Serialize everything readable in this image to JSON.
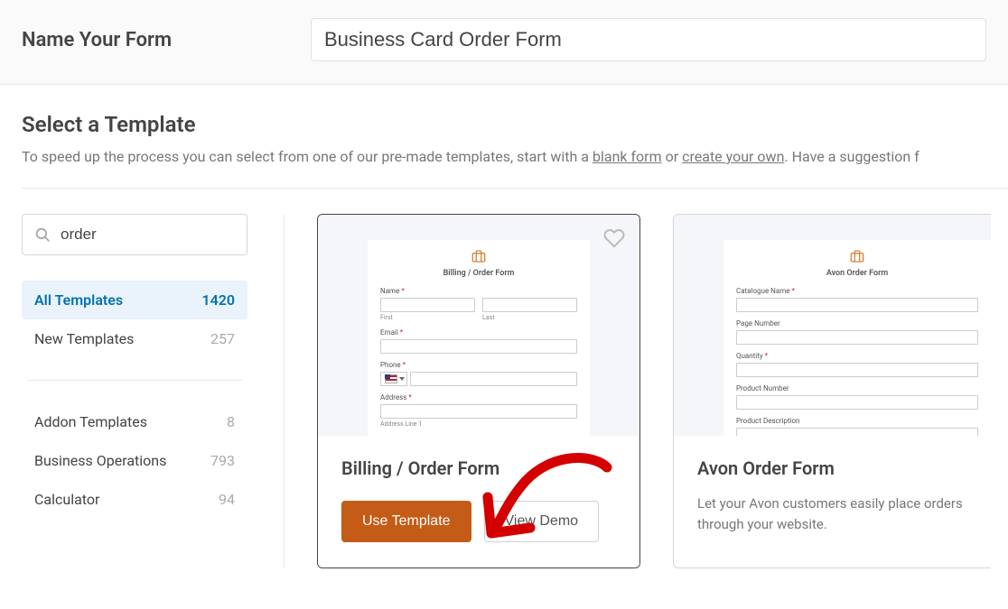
{
  "header": {
    "label": "Name Your Form",
    "value": "Business Card Order Form"
  },
  "section": {
    "title": "Select a Template",
    "subtitle_before": "To speed up the process you can select from one of our pre-made templates, start with a ",
    "blank_link": "blank form",
    "or": " or ",
    "create_link": "create your own",
    "subtitle_after": ". Have a suggestion f"
  },
  "search": {
    "value": "order"
  },
  "categories": {
    "primary": [
      {
        "label": "All Templates",
        "count": "1420"
      },
      {
        "label": "New Templates",
        "count": "257"
      }
    ],
    "secondary": [
      {
        "label": "Addon Templates",
        "count": "8"
      },
      {
        "label": "Business Operations",
        "count": "793"
      },
      {
        "label": "Calculator",
        "count": "94"
      }
    ]
  },
  "cards": [
    {
      "preview_title": "Billing / Order Form",
      "fields": {
        "name": "Name",
        "first": "First",
        "last": "Last",
        "email": "Email",
        "phone": "Phone",
        "address": "Address",
        "addr1": "Address Line 1"
      },
      "title": "Billing / Order Form",
      "use_btn": "Use Template",
      "demo_btn": "View Demo"
    },
    {
      "preview_title": "Avon Order Form",
      "fields": {
        "catalogue": "Catalogue Name",
        "page": "Page Number",
        "qty": "Quantity",
        "prodnum": "Product Number",
        "proddesc": "Product Description"
      },
      "title": "Avon Order Form",
      "desc": "Let your Avon customers easily place orders through your website."
    }
  ]
}
